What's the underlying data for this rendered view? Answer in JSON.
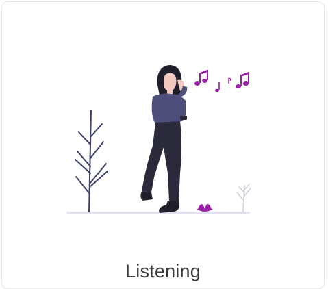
{
  "card": {
    "label": "Listening",
    "illustration": "person-listening-to-music-illustration"
  },
  "colors": {
    "accent": "#9b1fa6",
    "shirt": "#4d4f7a",
    "pants": "#2a2a3a",
    "hair": "#1f1f2b",
    "skin": "#f3c9c2",
    "ground": "#e4e2ef",
    "plant": "#3b3f6b",
    "plant_light": "#cfcfdc"
  }
}
